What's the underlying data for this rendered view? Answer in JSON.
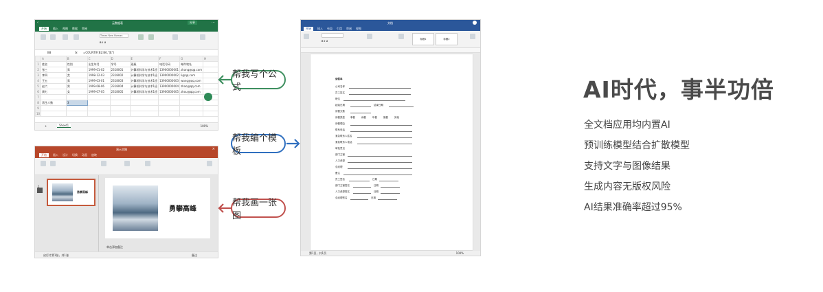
{
  "excel": {
    "title": "云数据表",
    "tabs": [
      "开始",
      "插入",
      "视图",
      "数据",
      "审阅"
    ],
    "buttons": [
      "分享"
    ],
    "font_name": "Times New Roman",
    "cell_ref": "B8",
    "formula": "=COUNTIF(B2:B6,\"男\")",
    "columns": [
      "A",
      "B",
      "C",
      "D",
      "E",
      "F",
      "G",
      "H"
    ],
    "headers": [
      "姓名",
      "性别",
      "出生年月",
      "学号",
      "班级",
      "电话号码",
      "邮件地址"
    ],
    "rows": [
      [
        "张三",
        "男",
        "1999-01-02",
        "2318001",
        "计算机科学与技术1班",
        "13900000001",
        "zhang@qq.com"
      ],
      [
        "李四",
        "女",
        "1998-12-03",
        "2318002",
        "计算机科学与技术1班",
        "13900000002",
        "li@qq.com"
      ],
      [
        "王五",
        "男",
        "1999-03-01",
        "2318003",
        "计算机科学与技术1班",
        "13900000003",
        "wang@qq.com"
      ],
      [
        "赵六",
        "男",
        "1999-08-06",
        "2318004",
        "计算机科学与技术1班",
        "13900000004",
        "zhao@qq.com"
      ],
      [
        "周七",
        "女",
        "1999-07-05",
        "2318005",
        "计算机科学与技术1班",
        "13900000005",
        "zhou@qq.com"
      ]
    ],
    "summary_label": "男生人数",
    "summary_value": "3",
    "sheet_tab": "Sheet1",
    "zoom": "100%"
  },
  "ppt": {
    "title": "演示文稿",
    "tabs": [
      "开始",
      "插入",
      "设计",
      "切换",
      "动画",
      "放映"
    ],
    "slide_number": "1",
    "slide_title": "勇攀高峰",
    "notes_placeholder": "单击添加备注",
    "status_left": "幻灯片第1张，共1张",
    "status_right": "备注"
  },
  "word": {
    "title": "文档",
    "tabs": [
      "开始",
      "插入",
      "布局",
      "引用",
      "审阅",
      "视图"
    ],
    "style_names": [
      "标题1",
      "标题2"
    ],
    "fields": [
      "请假单",
      "公司名称",
      "员工姓名",
      "职位",
      "起始日期",
      "结束日期",
      "请假天数",
      "请假类型",
      "请假理由",
      "联系电话",
      "紧急联系人姓名",
      "紧急联系人电话",
      "审批意见",
      "部门主管",
      "人力资源",
      "总经理",
      "备注",
      "员工签名",
      "部门主管签名",
      "人力资源签名",
      "总经理签名"
    ],
    "date_label": "日期",
    "leave_types": [
      "事假",
      "病假",
      "年假",
      "婚假",
      "其他"
    ],
    "status_left": "第1页，共1页",
    "status_right": "100%"
  },
  "callouts": [
    {
      "text": "帮我写个公式",
      "color": "#3e8f5f"
    },
    {
      "text": "帮我编个模板",
      "color": "#2f6fbf"
    },
    {
      "text": "帮我画一张图",
      "color": "#c0504d"
    }
  ],
  "headline": "AI时代，事半功倍",
  "features": [
    "全文档应用均内置AI",
    "预训练模型结合扩散模型",
    "支持文字与图像结果",
    "生成内容无版权风险",
    "AI结果准确率超过95%"
  ]
}
